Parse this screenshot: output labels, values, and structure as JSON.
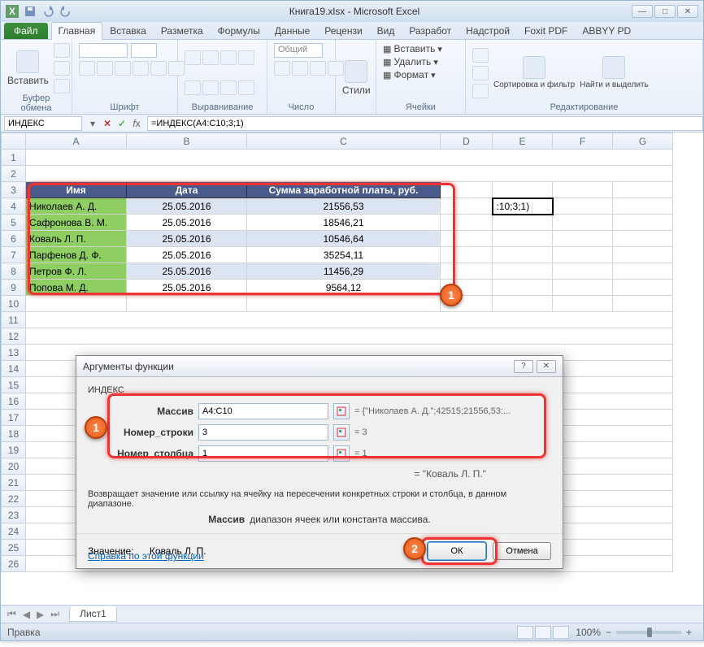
{
  "titlebar": {
    "title": "Книга19.xlsx - Microsoft Excel"
  },
  "ribbon": {
    "file": "Файл",
    "tabs": [
      "Главная",
      "Вставка",
      "Разметка",
      "Формулы",
      "Данные",
      "Рецензи",
      "Вид",
      "Разработ",
      "Надстрой",
      "Foxit PDF",
      "ABBYY PD"
    ],
    "groups": {
      "clipboard": {
        "paste": "Вставить",
        "label": "Буфер обмена"
      },
      "font": {
        "label": "Шрифт"
      },
      "alignment": {
        "label": "Выравнивание"
      },
      "number": {
        "format": "Общий",
        "label": "Число"
      },
      "styles": {
        "btn": "Стили"
      },
      "cells": {
        "insert": "Вставить",
        "delete": "Удалить",
        "format": "Формат",
        "label": "Ячейки"
      },
      "editing": {
        "sort": "Сортировка и фильтр",
        "find": "Найти и выделить",
        "label": "Редактирование"
      }
    }
  },
  "formula_bar": {
    "name_box": "ИНДЕКС",
    "formula": "=ИНДЕКС(A4:C10;3;1)"
  },
  "columns": [
    "A",
    "B",
    "C",
    "D",
    "E",
    "F",
    "G"
  ],
  "headers": {
    "name": "Имя",
    "date": "Дата",
    "sum": "Сумма заработной платы, руб."
  },
  "rows": [
    {
      "name": "Николаев А. Д.",
      "date": "25.05.2016",
      "sum": "21556,53"
    },
    {
      "name": "Сафронова В. М.",
      "date": "25.05.2016",
      "sum": "18546,21"
    },
    {
      "name": "Коваль Л. П.",
      "date": "25.05.2016",
      "sum": "10546,64"
    },
    {
      "name": "Парфенов Д. Ф.",
      "date": "25.05.2016",
      "sum": "35254,11"
    },
    {
      "name": "Петров Ф. Л.",
      "date": "25.05.2016",
      "sum": "11456,29"
    },
    {
      "name": "Попова М. Д.",
      "date": "25.05.2016",
      "sum": "9564,12"
    }
  ],
  "active_cell_display": ":10;3;1)",
  "dialog": {
    "title": "Аргументы функции",
    "func_name": "ИНДЕКС",
    "args": {
      "array": {
        "label": "Массив",
        "value": "A4:C10",
        "result": "= {\"Николаев А. Д.\";42515;21556,53:..."
      },
      "row": {
        "label": "Номер_строки",
        "value": "3",
        "result": "= 3"
      },
      "col": {
        "label": "Номер_столбца",
        "value": "1",
        "result": "= 1"
      }
    },
    "preview": "= \"Коваль Л. П.\"",
    "description": "Возвращает значение или ссылку на ячейку на пересечении конкретных строки и столбца, в данном диапазоне.",
    "arg_desc_label": "Массив",
    "arg_desc": "диапазон ячеек или константа массива.",
    "value_label": "Значение:",
    "value": "Коваль Л. П.",
    "help": "Справка по этой функции",
    "ok": "ОК",
    "cancel": "Отмена"
  },
  "status": {
    "mode": "Правка",
    "zoom": "100%"
  },
  "sheet_tab": "Лист1",
  "chart_data": {
    "type": "table",
    "title": "Сумма заработной платы, руб.",
    "categories": [
      "Николаев А. Д.",
      "Сафронова В. М.",
      "Коваль Л. П.",
      "Парфенов Д. Ф.",
      "Петров Ф. Л.",
      "Попова М. Д."
    ],
    "values": [
      21556.53,
      18546.21,
      10546.64,
      35254.11,
      11456.29,
      9564.12
    ]
  }
}
